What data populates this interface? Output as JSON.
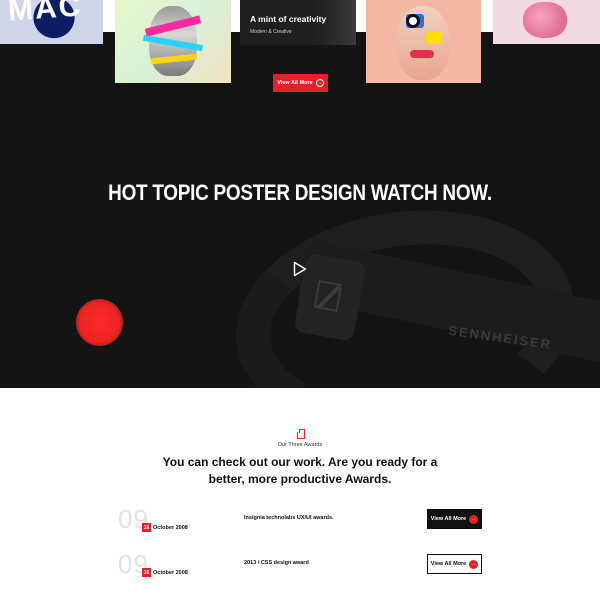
{
  "gallery": {
    "card1_letters": "MAC",
    "card3_title": "A mint of creativity",
    "card3_subtitle": "Modern & Creative",
    "view_all_label": "View All More",
    "arrow_icon": "arrow-right-icon"
  },
  "hero": {
    "title": "HOT TOPIC POSTER DESIGN WATCH NOW.",
    "brand": "SENNHEISER",
    "play_icon": "play-icon",
    "accent_color": "#e32227"
  },
  "awards": {
    "kicker": "Our Three Awards",
    "heading": "You can check out our work. Are you ready for a better, more productive Awards.",
    "items": [
      {
        "number": "09",
        "day": "16",
        "month_year": "October 2008",
        "name": "Insignia technolabs UX/UI awards.",
        "button": "View All More"
      },
      {
        "number": "09",
        "day": "16",
        "month_year": "October 2008",
        "name": "2013 / CSS design award",
        "button": "View All More"
      }
    ]
  }
}
